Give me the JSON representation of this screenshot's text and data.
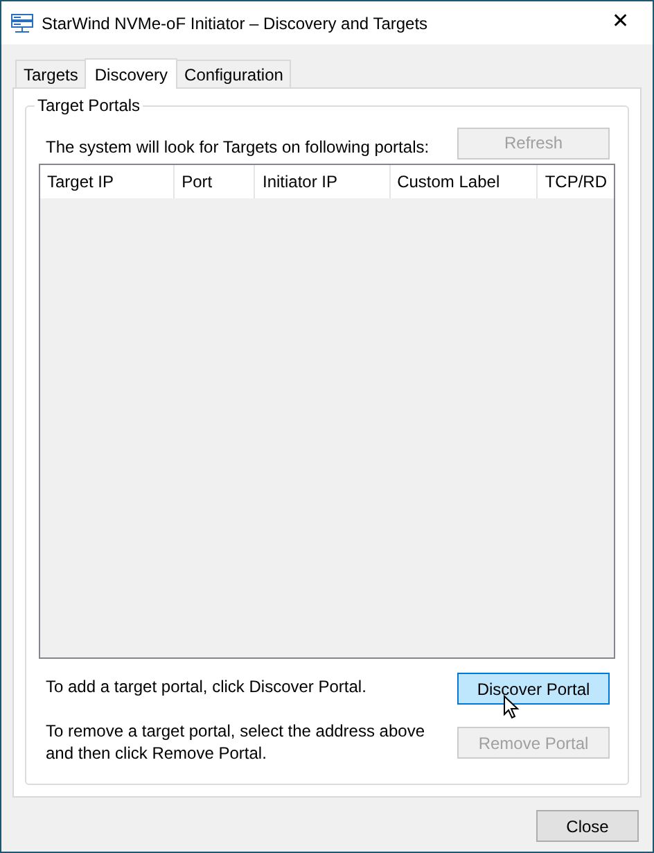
{
  "window": {
    "title": "StarWind NVMe-oF Initiator – Discovery and Targets",
    "close": "✕"
  },
  "tabs": [
    {
      "label": "Targets",
      "selected": false
    },
    {
      "label": "Discovery",
      "selected": true
    },
    {
      "label": "Configuration",
      "selected": false
    }
  ],
  "group": {
    "title": "Target Portals",
    "intro": "The system will look for Targets on following portals:",
    "refresh": {
      "label": "Refresh",
      "disabled": true
    },
    "table": {
      "columns": [
        "Target IP",
        "Port",
        "Initiator IP",
        "Custom Label",
        "TCP/RD"
      ]
    },
    "add_hint": "To add a target portal, click Discover Portal.",
    "discover": {
      "label": "Discover Portal",
      "disabled": false,
      "hovered": true
    },
    "remove_hint": "To remove a target portal, select the address above and then click Remove Portal.",
    "remove": {
      "label": "Remove Portal",
      "disabled": true
    }
  },
  "buttons": [
    {
      "label": "Close",
      "disabled": false,
      "hovered": false
    }
  ]
}
